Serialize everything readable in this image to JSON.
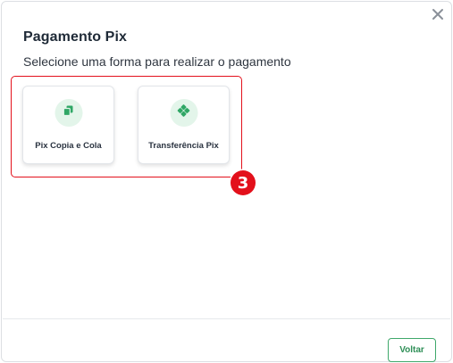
{
  "dialog": {
    "title": "Pagamento Pix",
    "subtitle": "Selecione uma forma para realizar o pagamento",
    "close_icon": "close-icon"
  },
  "options": [
    {
      "label": "Pix Copia e Cola",
      "icon": "copy-icon"
    },
    {
      "label": "Transferência Pix",
      "icon": "pix-icon"
    }
  ],
  "annotation": {
    "step": "3"
  },
  "footer": {
    "back_label": "Voltar"
  },
  "colors": {
    "accent_green": "#2f8f57",
    "icon_bg": "#e3f5ea",
    "highlight_red": "#e3101b"
  }
}
